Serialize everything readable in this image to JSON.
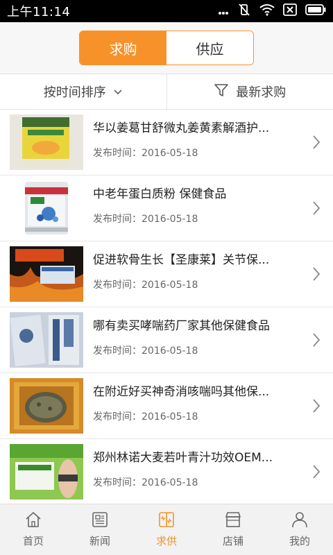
{
  "status_bar": {
    "time": "上午11:14"
  },
  "segment": {
    "tabs": [
      {
        "label": "求购",
        "active": true
      },
      {
        "label": "供应",
        "active": false
      }
    ]
  },
  "filter": {
    "sort_label": "按时间排序",
    "latest_label": "最新求购"
  },
  "list": {
    "items": [
      {
        "title": "华以姜葛甘舒微丸姜黄素解酒护...",
        "date_label": "发布时间：2016-05-18"
      },
      {
        "title": "中老年蛋白质粉 保健食品",
        "date_label": "发布时间：2016-05-18"
      },
      {
        "title": "促进软骨生长【圣康莱】关节保...",
        "date_label": "发布时间：2016-05-18"
      },
      {
        "title": "哪有卖买哮喘药厂家其他保健食品",
        "date_label": "发布时间：2016-05-18"
      },
      {
        "title": "在附近好买神奇消咳喘吗其他保...",
        "date_label": "发布时间：2016-05-18"
      },
      {
        "title": "郑州林诺大麦若叶青汁功效OEM...",
        "date_label": "发布时间：2016-05-18"
      }
    ]
  },
  "nav": {
    "items": [
      {
        "label": "首页",
        "icon": "home-icon"
      },
      {
        "label": "新闻",
        "icon": "news-icon"
      },
      {
        "label": "求供",
        "icon": "supply-demand-icon",
        "active": true
      },
      {
        "label": "店铺",
        "icon": "store-icon"
      },
      {
        "label": "我的",
        "icon": "profile-icon"
      }
    ]
  },
  "colors": {
    "accent": "#f7922a",
    "text": "#222222",
    "muted": "#666666"
  }
}
